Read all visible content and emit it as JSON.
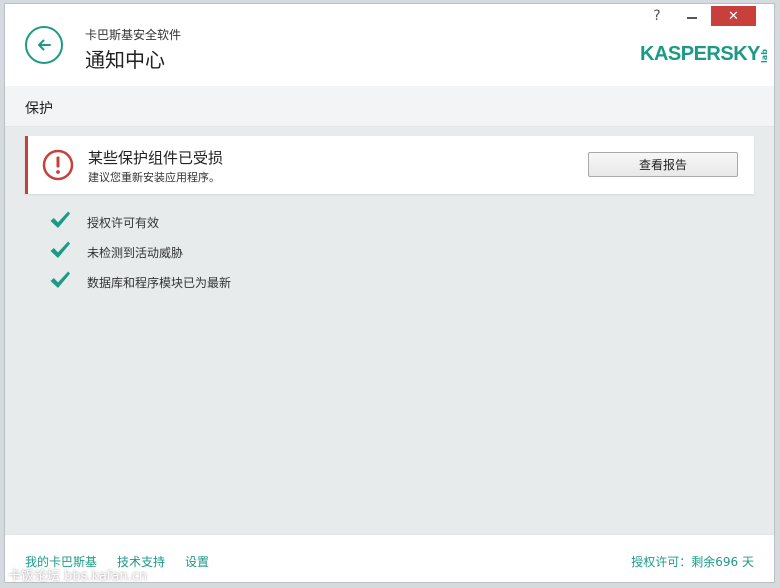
{
  "window": {
    "app_name": "卡巴斯基安全软件",
    "page_title": "通知中心",
    "help_label": "?",
    "close_label": "✕",
    "logo_text": "KASPERSKY",
    "logo_lab": "lab"
  },
  "section": {
    "title": "保护"
  },
  "alert": {
    "title": "某些保护组件已受损",
    "subtitle": "建议您重新安装应用程序。",
    "button_label": "查看报告"
  },
  "status_items": [
    {
      "label": "授权许可有效",
      "icon": "check-icon"
    },
    {
      "label": "未检测到活动威胁",
      "icon": "check-icon"
    },
    {
      "label": "数据库和程序模块已为最新",
      "icon": "check-icon"
    }
  ],
  "footer": {
    "links": [
      "我的卡巴斯基",
      "技术支持",
      "设置"
    ],
    "license_status": "授权许可：剩余696 天"
  },
  "watermark": "卡饭论坛 bbs.kafan.cn",
  "colors": {
    "accent": "#1c9a86",
    "alert": "#c7403b",
    "close": "#c7403b"
  }
}
